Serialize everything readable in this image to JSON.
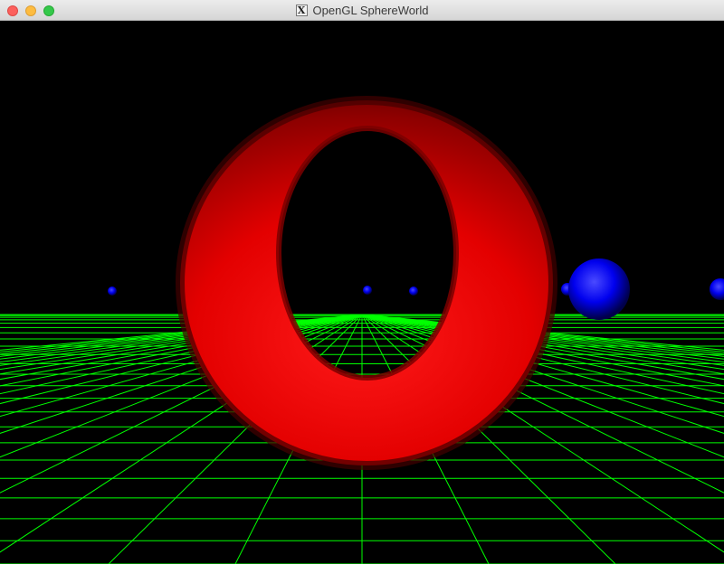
{
  "window": {
    "title": "OpenGL SphereWorld",
    "icon": "x11-icon",
    "controls": [
      "close-button",
      "minimize-button",
      "zoom-button"
    ]
  },
  "scene": {
    "background": "#000000",
    "grid_color": "#00ff00",
    "torus_color": "#ff0000",
    "sphere_color": "#0000ff"
  }
}
